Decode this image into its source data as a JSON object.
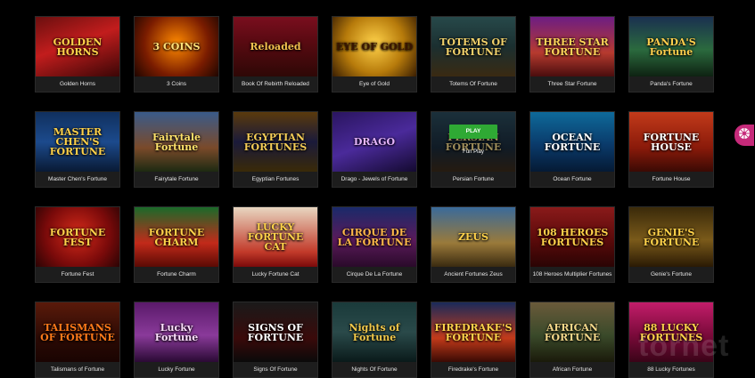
{
  "games": [
    {
      "label": "Golden Horns",
      "art": "GOLDEN HORNS",
      "bg": "linear-gradient(160deg,#6b0f0f,#c21d1d 45%,#3a0606)",
      "fg": "#ffd24a"
    },
    {
      "label": "3 Coins",
      "art": "3 COINS",
      "bg": "radial-gradient(circle at 50% 45%,#ff8a00,#7a1c00 60%,#1e0600)",
      "fg": "#ffe27a"
    },
    {
      "label": "Book Of Rebirth Reloaded",
      "art": "Reloaded",
      "bg": "linear-gradient(180deg,#7a0e1e,#5a0a12 40%,#2e0806)",
      "fg": "#f2c14e"
    },
    {
      "label": "Eye of Gold",
      "art": "EYE OF GOLD",
      "bg": "radial-gradient(circle at 50% 45%,#ffd24a,#b77b0b 55%,#3a1e02)",
      "fg": "#3a1500"
    },
    {
      "label": "Totems Of Fortune",
      "art": "TOTEMS OF FORTUNE",
      "bg": "linear-gradient(180deg,#27494a,#1b2f30 50%,#3a2a12)",
      "fg": "#f1d16b"
    },
    {
      "label": "Three Star Fortune",
      "art": "THREE STAR FORTUNE",
      "bg": "linear-gradient(180deg,#6d1d84,#b63a2f 60%,#4a0d0d)",
      "fg": "#ffd65a"
    },
    {
      "label": "Panda's Fortune",
      "art": "PANDA'S Fortune",
      "bg": "linear-gradient(180deg,#1a3050,#2b6a3e 55%,#0e2212)",
      "fg": "#ffcf4d"
    },
    {
      "label": "Master Chen's Fortune",
      "art": "MASTER CHEN'S FORTUNE",
      "bg": "linear-gradient(180deg,#10305e,#1c4a8c 50%,#091a34)",
      "fg": "#ffd24a"
    },
    {
      "label": "Fairytale Fortune",
      "art": "Fairytale Fortune",
      "bg": "linear-gradient(180deg,#3a5b8a,#7a4a2a 60%,#1d2a12)",
      "fg": "#ffe36b"
    },
    {
      "label": "Egyptian Fortunes",
      "art": "EGYPTIAN FORTUNES",
      "bg": "linear-gradient(180deg,#5a3a0c,#1a1a3a 50%,#3a2a08)",
      "fg": "#f4cd57"
    },
    {
      "label": "Drago - Jewels of Fortune",
      "art": "DRAGO",
      "bg": "linear-gradient(160deg,#2a1560,#4a2a9a 50%,#140a30)",
      "fg": "#e7b6ff"
    },
    {
      "label": "Persian Fortune",
      "art": "PERSIAN FORTUNE",
      "bg": "linear-gradient(180deg,#2a4a5a,#1a2a3a 60%,#3a2a1a)",
      "fg": "#f1d88a",
      "hover": true,
      "play": "PLAY",
      "fun": "Fun Play"
    },
    {
      "label": "Ocean Fortune",
      "art": "OCEAN FORTUNE",
      "bg": "linear-gradient(180deg,#0e6a9a,#0a3a6a 55%,#051a34)",
      "fg": "#ffffff"
    },
    {
      "label": "Fortune House",
      "art": "FORTUNE HOUSE",
      "bg": "linear-gradient(180deg,#c23a1a,#8a1a0a 60%,#3a0a04)",
      "fg": "#ffffff"
    },
    {
      "label": "Fortune Fest",
      "art": "FORTUNE FEST",
      "bg": "radial-gradient(circle at 50% 45%,#d42a1a,#7a0a0a 60%,#2a0404)",
      "fg": "#ffd24a"
    },
    {
      "label": "Fortune Charm",
      "art": "FORTUNE CHARM",
      "bg": "linear-gradient(180deg,#1a6a2a,#c22a1a 60%,#5a0a04)",
      "fg": "#ffd24a"
    },
    {
      "label": "Lucky Fortune Cat",
      "art": "LUCKY FORTUNE CAT",
      "bg": "linear-gradient(180deg,#e8d6c0,#c23a2a 75%,#7a0a0a)",
      "fg": "#ffd24a"
    },
    {
      "label": "Cirque De La Fortune",
      "art": "CIRQUE DE LA FORTUNE",
      "bg": "linear-gradient(180deg,#1a2a6a,#5a1a5a 55%,#2a0a2a)",
      "fg": "#ffb84a"
    },
    {
      "label": "Ancient Fortunes Zeus",
      "art": "ZEUS",
      "bg": "linear-gradient(180deg,#3a6a9a,#9a7a3a 60%,#3a2a10)",
      "fg": "#ffd24a"
    },
    {
      "label": "108 Heroes Multiplier Fortunes",
      "art": "108 HEROES FORTUNES",
      "bg": "linear-gradient(180deg,#8a1a1a,#5a0a0a 55%,#2a0404)",
      "fg": "#ffd24a"
    },
    {
      "label": "Genie's Fortune",
      "art": "GENIE'S FORTUNE",
      "bg": "linear-gradient(180deg,#3a2a0a,#7a5a1a 55%,#2a1a04)",
      "fg": "#ffd24a"
    },
    {
      "label": "Talismans of Fortune",
      "art": "TALISMANS OF FORTUNE",
      "bg": "linear-gradient(180deg,#5a1a0a,#2a0a04 60%,#1a0402)",
      "fg": "#ff7a1a"
    },
    {
      "label": "Lucky Fortune",
      "art": "Lucky Fortune",
      "bg": "linear-gradient(180deg,#5a1a6a,#8a3a9a 55%,#2a0a34)",
      "fg": "#ffe0ff"
    },
    {
      "label": "Signs Of Fortune",
      "art": "SIGNS OF FORTUNE",
      "bg": "linear-gradient(180deg,#1a1a1a,#3a0a0a 60%,#0a0a0a)",
      "fg": "#ffffff"
    },
    {
      "label": "Nights Of Fortune",
      "art": "Nights of Fortune",
      "bg": "linear-gradient(180deg,#1a3a3a,#2a4a4a 50%,#0a1a1a)",
      "fg": "#f1c84a"
    },
    {
      "label": "Firedrake's Fortune",
      "art": "FIREDRAKE'S FORTUNE",
      "bg": "linear-gradient(180deg,#1a2a5a,#c23a1a 60%,#3a0a04)",
      "fg": "#ffd24a"
    },
    {
      "label": "African Fortune",
      "art": "AFRICAN FORTUNE",
      "bg": "linear-gradient(180deg,#6a5a3a,#3a4a2a 55%,#1a1a0a)",
      "fg": "#f4d88a"
    },
    {
      "label": "88 Lucky Fortunes",
      "art": "88 LUCKY FORTUNES",
      "bg": "linear-gradient(180deg,#c21d6a,#7a0a3a 55%,#3a0418)",
      "fg": "#ffd24a"
    }
  ],
  "side_widget": {
    "icon": "wheel-icon",
    "color": "#c62a7a"
  },
  "watermark": "tornet"
}
